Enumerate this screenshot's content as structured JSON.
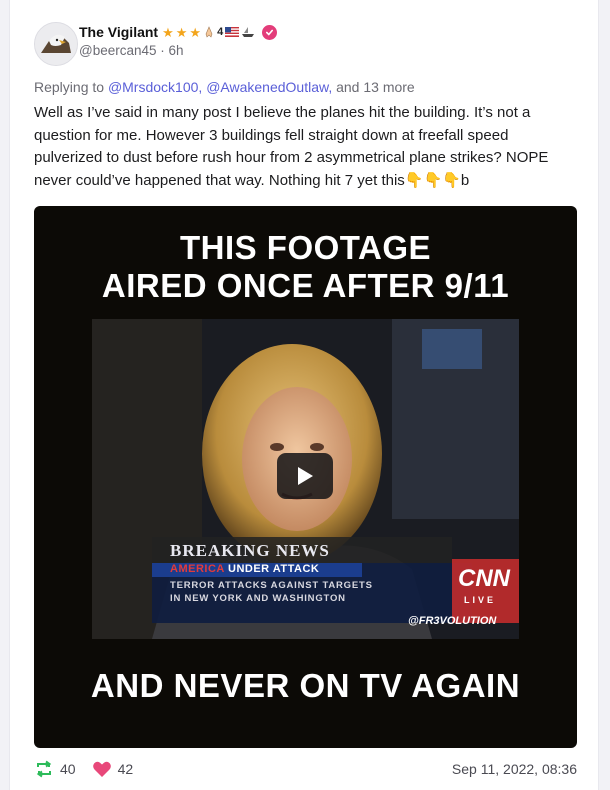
{
  "post": {
    "author": {
      "name": "The Vigilant",
      "flair_number": "4",
      "handle": "@beercan45",
      "time_ago": "6h"
    },
    "reply": {
      "prefix": "Replying to",
      "mention1": "@Mrsdock100,",
      "mention2": "@AwakenedOutlaw,",
      "suffix": "and 13 more"
    },
    "text": "Well as I’ve said in many post I believe the planes hit the building. It’s not a question for me. However 3 buildings fell straight down at freefall speed pulverized to dust before rush hour from 2 asymmetrical plane strikes? NOPE never could’ve happened that way. Nothing hit 7 yet this👇👇👇b",
    "video": {
      "top_caption_line1": "THIS FOOTAGE",
      "top_caption_line2": "AIRED ONCE AFTER 9/11",
      "bottom_caption": "AND NEVER ON TV AGAIN",
      "banner_breaking": "BREAKING NEWS",
      "banner_headline_red": "AMERICA",
      "banner_headline_white": "UNDER ATTACK",
      "banner_sub1": "TERROR ATTACKS AGAINST TARGETS",
      "banner_sub2": "IN NEW YORK AND WASHINGTON",
      "network_logo": "CNN",
      "network_live": "LIVE",
      "watermark": "@FR3VOLUTION"
    },
    "stats": {
      "reposts": "40",
      "likes": "42",
      "date": "Sep 11, 2022, 08:36"
    }
  },
  "colors": {
    "accent": "#5a5fd8",
    "star": "#f3a51c",
    "verified": "#e33d7a",
    "repost_icon": "#2dbb5a",
    "heart_icon": "#e8487a"
  },
  "icons": [
    "eagle-avatar",
    "star-icon",
    "praying-hands-emoji",
    "us-flag-emoji",
    "boat-emoji",
    "verified-icon",
    "play-icon",
    "repost-icon",
    "heart-icon"
  ]
}
